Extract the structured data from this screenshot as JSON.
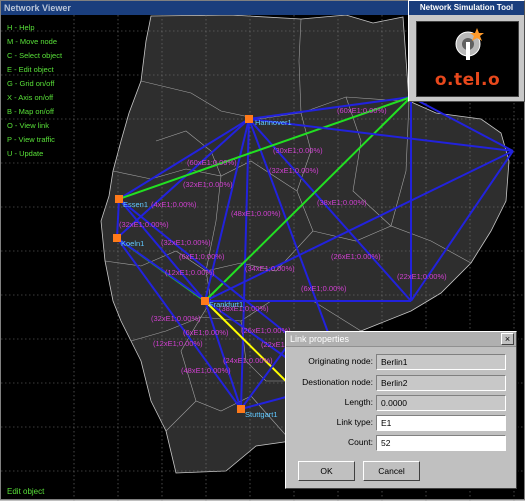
{
  "viewer": {
    "title": "Network Viewer",
    "status": "Edit object",
    "help_menu": [
      {
        "label": "H - Help"
      },
      {
        "label": "M - Move node"
      },
      {
        "label": "C - Select object"
      },
      {
        "label": "E - Edit object"
      },
      {
        "label": "G - Grid on/off"
      },
      {
        "label": "X - Axis on/off"
      },
      {
        "label": "B - Map on/off"
      },
      {
        "label": "O - View link"
      },
      {
        "label": "P - View traffic"
      },
      {
        "label": "U - Update"
      }
    ]
  },
  "logo_panel": {
    "title": "Network Simulation Tool",
    "logo_text": "o.tel.o"
  },
  "nodes": [
    {
      "id": "hannover",
      "label": "Hannover1"
    },
    {
      "id": "essen",
      "label": "Essen1"
    },
    {
      "id": "koeln",
      "label": "Koeln1"
    },
    {
      "id": "frankfurt",
      "label": "Frankfurt1"
    },
    {
      "id": "stuttgart",
      "label": "Stuttgart1"
    }
  ],
  "link_labels": [
    {
      "text": "(60xE1;0.00%)"
    },
    {
      "text": "(30xE1;0.00%)"
    },
    {
      "text": "(32xE1;0.00%)"
    },
    {
      "text": "(60xE1;0.00%)"
    },
    {
      "text": "(32xE1;0.00%)"
    },
    {
      "text": "(48xE1;0.00%)"
    },
    {
      "text": "(38xE1;0.00%)"
    },
    {
      "text": "(32xE1;0.00%)"
    },
    {
      "text": "(4xE1;0.00%)"
    },
    {
      "text": "(6xE1;0.00%)"
    },
    {
      "text": "(34xE1;0.00%)"
    },
    {
      "text": "(26xE1;0.00%)"
    },
    {
      "text": "(32xE1;0.00%)"
    },
    {
      "text": "(22xE1;0.00%)"
    },
    {
      "text": "(12xE1;0.00%)"
    },
    {
      "text": "(6xE1;0.00%)"
    },
    {
      "text": "(38xE1;0.00%)"
    },
    {
      "text": "(32xE1;0.00%)"
    },
    {
      "text": "(6xE1;0.00%)"
    },
    {
      "text": "(26xE1;0.00%)"
    },
    {
      "text": "(22xE1;0.00%)"
    },
    {
      "text": "(24xE1;0.00%)"
    },
    {
      "text": "(12xE1;0.00%)"
    },
    {
      "text": "(48xE1;0.00%)"
    }
  ],
  "dialog": {
    "title": "Link properties",
    "close_label": "×",
    "originating_node_label": "Originating node:",
    "originating_node_value": "Berlin1",
    "destination_node_label": "Destionation node:",
    "destination_node_value": "Berlin2",
    "length_label": "Length:",
    "length_value": "0.0000",
    "link_type_label": "Link type:",
    "link_type_value": "E1",
    "count_label": "Count:",
    "count_value": "52",
    "ok_label": "OK",
    "cancel_label": "Cancel"
  },
  "colors": {
    "link_blue": "#2222dd",
    "link_green": "#22e022",
    "link_yellow": "#ffff00",
    "link_label": "#d040d0",
    "node": "#ff7a1a",
    "node_label": "#60c8ff",
    "help_text": "#58e038",
    "grid": "#7a7a7a",
    "land": "#2e2e2e",
    "border": "#c8c8c8"
  }
}
